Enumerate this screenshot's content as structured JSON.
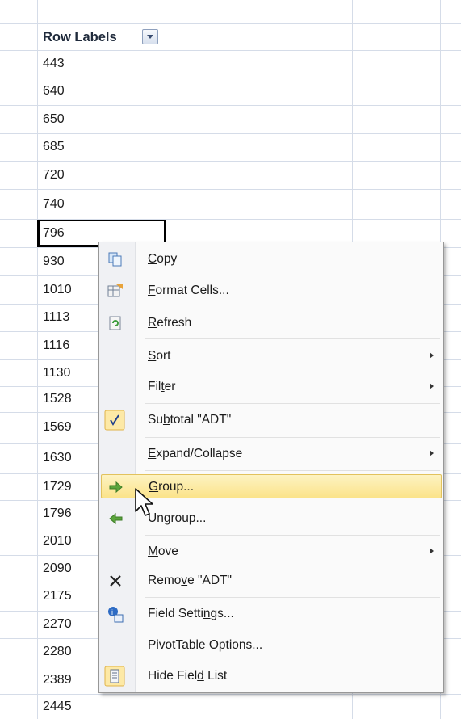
{
  "pivot": {
    "header": "Row Labels",
    "dropdown_icon": "dropdown-arrow-icon",
    "rows": [
      "443",
      "640",
      "650",
      "685",
      "720",
      "740",
      "796",
      "930",
      "1010",
      "1113",
      "1116",
      "1130",
      "1528",
      "1569",
      "1630",
      "1729",
      "1796",
      "2010",
      "2090",
      "2175",
      "2270",
      "2280",
      "2389",
      "2445"
    ],
    "selected_row": "796"
  },
  "menu": {
    "items": [
      {
        "pre": "",
        "mn": "C",
        "post": "opy",
        "icon": "copy-icon"
      },
      {
        "pre": "",
        "mn": "F",
        "post": "ormat Cells...",
        "icon": "format-cells-icon"
      },
      {
        "pre": "",
        "mn": "R",
        "post": "efresh",
        "icon": "refresh-icon"
      },
      {
        "pre": "",
        "mn": "S",
        "post": "ort",
        "icon": ""
      },
      {
        "pre": "Fil",
        "mn": "t",
        "post": "er",
        "icon": ""
      },
      {
        "pre": "Su",
        "mn": "b",
        "post": "total \"ADT\"",
        "icon": "checkmark-icon"
      },
      {
        "pre": "",
        "mn": "E",
        "post": "xpand/Collapse",
        "icon": ""
      },
      {
        "pre": "",
        "mn": "G",
        "post": "roup...",
        "icon": "group-arrow-icon"
      },
      {
        "pre": "",
        "mn": "U",
        "post": "ngroup...",
        "icon": "ungroup-arrow-icon"
      },
      {
        "pre": "",
        "mn": "M",
        "post": "ove",
        "icon": ""
      },
      {
        "pre": "Remo",
        "mn": "v",
        "post": "e \"ADT\"",
        "icon": "remove-x-icon"
      },
      {
        "pre": "Field Setti",
        "mn": "n",
        "post": "gs...",
        "icon": "field-settings-icon"
      },
      {
        "pre": "PivotTable ",
        "mn": "O",
        "post": "ptions...",
        "icon": ""
      },
      {
        "pre": "Hide Fiel",
        "mn": "d",
        "post": " List",
        "icon": "field-list-icon"
      }
    ],
    "highlighted": "Group..."
  }
}
